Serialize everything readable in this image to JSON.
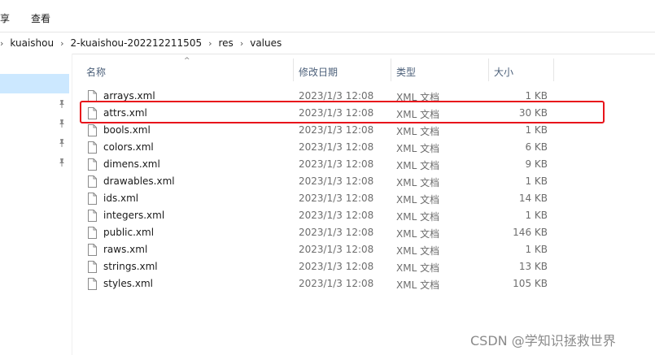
{
  "menu": {
    "share": "享",
    "view": "查看"
  },
  "breadcrumb": [
    "kuaishou",
    "2-kuaishou-202212211505",
    "res",
    "values"
  ],
  "columns": {
    "name": "名称",
    "date": "修改日期",
    "type": "类型",
    "size": "大小"
  },
  "files": [
    {
      "name": "arrays.xml",
      "date": "2023/1/3 12:08",
      "type": "XML 文档",
      "size": "1 KB"
    },
    {
      "name": "attrs.xml",
      "date": "2023/1/3 12:08",
      "type": "XML 文档",
      "size": "30 KB",
      "highlighted": true
    },
    {
      "name": "bools.xml",
      "date": "2023/1/3 12:08",
      "type": "XML 文档",
      "size": "1 KB"
    },
    {
      "name": "colors.xml",
      "date": "2023/1/3 12:08",
      "type": "XML 文档",
      "size": "6 KB"
    },
    {
      "name": "dimens.xml",
      "date": "2023/1/3 12:08",
      "type": "XML 文档",
      "size": "9 KB"
    },
    {
      "name": "drawables.xml",
      "date": "2023/1/3 12:08",
      "type": "XML 文档",
      "size": "1 KB"
    },
    {
      "name": "ids.xml",
      "date": "2023/1/3 12:08",
      "type": "XML 文档",
      "size": "14 KB"
    },
    {
      "name": "integers.xml",
      "date": "2023/1/3 12:08",
      "type": "XML 文档",
      "size": "1 KB"
    },
    {
      "name": "public.xml",
      "date": "2023/1/3 12:08",
      "type": "XML 文档",
      "size": "146 KB"
    },
    {
      "name": "raws.xml",
      "date": "2023/1/3 12:08",
      "type": "XML 文档",
      "size": "1 KB"
    },
    {
      "name": "strings.xml",
      "date": "2023/1/3 12:08",
      "type": "XML 文档",
      "size": "13 KB"
    },
    {
      "name": "styles.xml",
      "date": "2023/1/3 12:08",
      "type": "XML 文档",
      "size": "105 KB"
    }
  ],
  "watermark": "CSDN @学知识拯救世界",
  "colors": {
    "highlight_border": "#e8141b",
    "nav_selected": "#cce8ff",
    "header_text": "#4c607a"
  }
}
